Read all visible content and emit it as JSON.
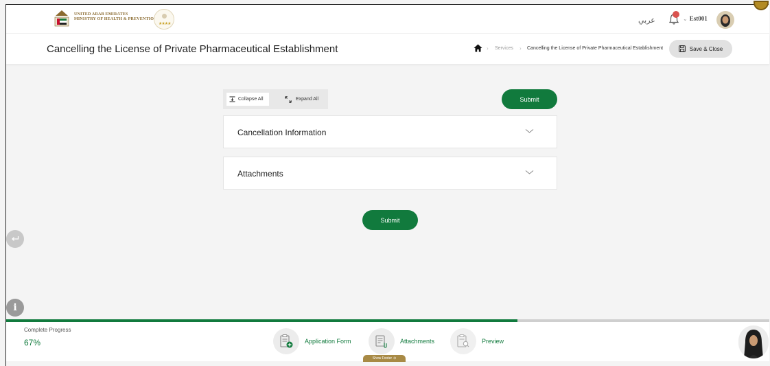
{
  "brand": {
    "line1": "UNITED ARAB EMIRATES",
    "line2": "MINISTRY OF HEALTH & PREVENTION",
    "gold_color": "#8a6a2f"
  },
  "topbar": {
    "language_label": "عربي",
    "username": "Est001"
  },
  "header": {
    "title": "Cancelling the License of Private Pharmaceutical Establishment",
    "breadcrumb": [
      "Services",
      "Cancelling the License of Private Pharmaceutical Establishment"
    ],
    "save_close_label": "Save & Close"
  },
  "controls": {
    "collapse_all_label": "Collapse All",
    "expand_all_label": "Expand All",
    "submit_label": "Submit"
  },
  "sections": [
    {
      "title": "Cancellation Information"
    },
    {
      "title": "Attachments"
    }
  ],
  "footer": {
    "progress_label": "Complete Progress",
    "progress_value": "67%",
    "progress_fraction": 0.67,
    "steps": [
      {
        "label": "Application Form",
        "icon": "form-add-icon"
      },
      {
        "label": "Attachments",
        "icon": "attachment-doc-icon"
      },
      {
        "label": "Preview",
        "icon": "preview-doc-icon"
      }
    ],
    "show_footer_label": "Show Footer"
  },
  "colors": {
    "primary_green": "#117a3d",
    "button_gray": "#e1e1e1",
    "background": "#f4f4f4"
  }
}
